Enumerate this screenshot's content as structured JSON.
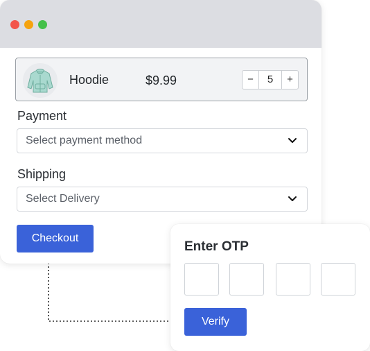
{
  "window": {
    "controls": [
      "close",
      "minimize",
      "maximize"
    ]
  },
  "product": {
    "name": "Hoodie",
    "price": "$9.99",
    "quantity": "5",
    "decrement_label": "−",
    "increment_label": "+",
    "image_icon": "hoodie-icon"
  },
  "payment": {
    "label": "Payment",
    "placeholder": "Select payment method"
  },
  "shipping": {
    "label": "Shipping",
    "placeholder": "Select Delivery"
  },
  "checkout": {
    "button_label": "Checkout"
  },
  "otp": {
    "title": "Enter OTP",
    "digits": [
      "",
      "",
      "",
      ""
    ],
    "verify_label": "Verify"
  },
  "colors": {
    "accent": "#3a62d9",
    "titlebar": "#dcdde2",
    "close": "#f2544a",
    "minimize": "#f5a30f",
    "maximize": "#45c04a"
  }
}
